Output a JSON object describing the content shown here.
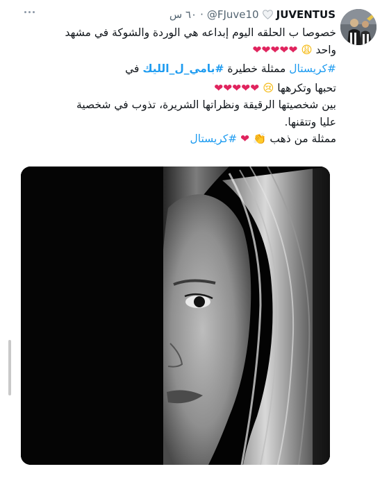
{
  "tweet": {
    "display_name": "JUVENTUS",
    "handle": "@FJuve10",
    "separator": "·",
    "timestamp": "٦٠ س",
    "lines": {
      "l1": "خصوصا ب الحلقه اليوم إبداعه هي الوردة والشوكة في مشهد",
      "l2_text": "واحد",
      "l2_emoji": "😩",
      "l2_hearts": "❤❤❤❤❤",
      "l3_hashtag1": "#كريستال",
      "l3_text": "ممثلة خطيرة",
      "l3_hashtag2": "#بامي_ل_الليك",
      "l3_end": "في",
      "l4_text": "تحبها وتكرهها",
      "l4_emoji": "😢",
      "l4_hearts": "❤❤❤❤❤",
      "l5": "بين شخصيتها الرقيقة ونظراتها الشريرة، تذوب في شخصية",
      "l6": "عليا وتتقنها.",
      "l7_text": "ممثلة من ذهب",
      "l7_emoji": "👏",
      "l7_heart": "❤",
      "l7_hashtag": "#كريستال"
    }
  },
  "colors": {
    "link": "#1d9bf0",
    "heart": "#e0245e",
    "text": "#0f1419",
    "muted": "#536471"
  },
  "icons": [
    "more-options-icon",
    "white-heart-icon",
    "avatar-image",
    "scroll-indicator"
  ]
}
